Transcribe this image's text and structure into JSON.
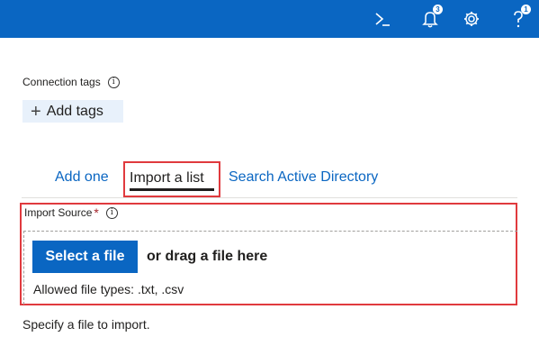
{
  "topbar": {
    "icons": [
      "terminal-icon",
      "bell-icon",
      "gear-icon",
      "help-icon"
    ],
    "notifications_count": "3",
    "help_count": "1"
  },
  "connection_tags": {
    "label": "Connection tags",
    "info_glyph": "i",
    "add_button": "Add tags"
  },
  "tabs": [
    {
      "label": "Add one",
      "selected": false
    },
    {
      "label": "Import a list",
      "selected": true
    },
    {
      "label": "Search Active Directory",
      "selected": false
    }
  ],
  "import": {
    "label": "Import Source",
    "required_mark": "*",
    "info_glyph": "i",
    "select_button": "Select a file",
    "drag_text": "or drag a file here",
    "allowed_types": "Allowed file types: .txt, .csv",
    "hint": "Specify a file to import."
  },
  "colors": {
    "accent": "#0a66c2",
    "highlight": "#e03a3e",
    "required": "#a4262c"
  }
}
